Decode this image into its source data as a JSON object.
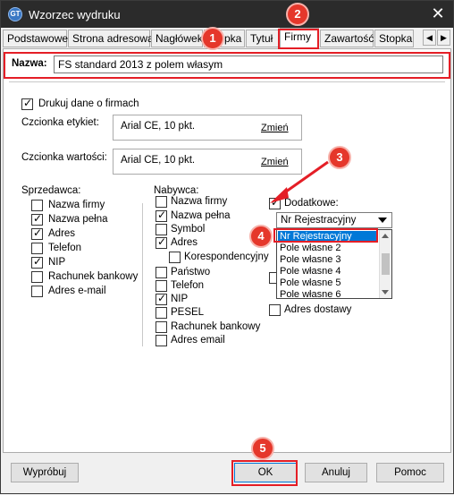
{
  "window": {
    "title": "Wzorzec wydruku",
    "icon_text": "GT",
    "close_glyph": "✕"
  },
  "tabs": [
    {
      "label": "Podstawowe"
    },
    {
      "label": "Strona adresowa"
    },
    {
      "label": "Nagłówek"
    },
    {
      "label": "Stopka"
    },
    {
      "label": "Tytuł"
    },
    {
      "label": "Firmy",
      "active": true
    },
    {
      "label": "Zawartość"
    },
    {
      "label": "Stopka"
    }
  ],
  "tab_nav": {
    "left": "◀",
    "right": "▶"
  },
  "name_field": {
    "label": "Nazwa:",
    "value": "FS standard 2013 z polem własym"
  },
  "print_company": {
    "label": "Drukuj dane o firmach",
    "checked": true
  },
  "label_font": {
    "label": "Czcionka etykiet:",
    "value": "Arial CE, 10 pkt.",
    "change": "Zmień"
  },
  "value_font": {
    "label": "Czcionka wartości:",
    "value": "Arial CE, 10 pkt.",
    "change": "Zmień"
  },
  "seller": {
    "title": "Sprzedawca:",
    "items": [
      {
        "label": "Nazwa firmy",
        "checked": false
      },
      {
        "label": "Nazwa pełna",
        "checked": true
      },
      {
        "label": "Adres",
        "checked": true
      },
      {
        "label": "Telefon",
        "checked": false
      },
      {
        "label": "NIP",
        "checked": true
      },
      {
        "label": "Rachunek bankowy",
        "checked": false
      },
      {
        "label": "Adres e-mail",
        "checked": false
      }
    ]
  },
  "buyer": {
    "title": "Nabywca:",
    "items": [
      {
        "label": "Nazwa firmy",
        "checked": false
      },
      {
        "label": "Nazwa pełna",
        "checked": true
      },
      {
        "label": "Symbol",
        "checked": false
      },
      {
        "label": "Adres",
        "checked": true
      },
      {
        "label": "Korespondencyjny",
        "checked": false
      },
      {
        "label": "Państwo",
        "checked": false
      },
      {
        "label": "Telefon",
        "checked": false
      },
      {
        "label": "NIP",
        "checked": true
      },
      {
        "label": "PESEL",
        "checked": false
      },
      {
        "label": "Rachunek bankowy",
        "checked": false
      },
      {
        "label": "Adres email",
        "checked": false
      }
    ]
  },
  "additional": {
    "label": "Dodatkowe:",
    "checked": true,
    "combo_value": "Nr Rejestracyjny",
    "options": [
      "Nr Rejestracyjny",
      "Pole własne 2",
      "Pole własne 3",
      "Pole własne 4",
      "Pole własne 5",
      "Pole własne 6"
    ],
    "selected_index": 0
  },
  "delivery_address": {
    "label": "Adres dostawy",
    "checked": false
  },
  "buttons": {
    "preview": "Wypróbuj",
    "ok": "OK",
    "cancel": "Anuluj",
    "help": "Pomoc"
  },
  "callouts": [
    "1",
    "2",
    "3",
    "4",
    "5"
  ],
  "colors": {
    "callout_red": "#e41e26",
    "selection_blue": "#0078d7",
    "titlebar": "#2b2b2b"
  }
}
